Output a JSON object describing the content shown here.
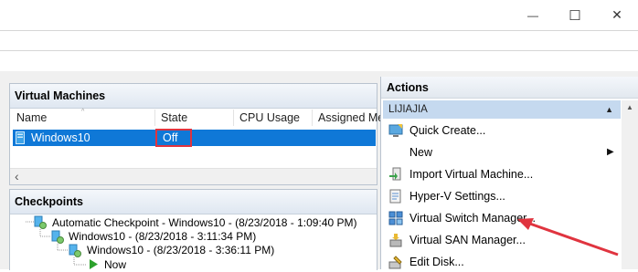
{
  "window": {
    "minimize_glyph": "—",
    "maximize_glyph": "☐",
    "close_glyph": "✕"
  },
  "vm_panel": {
    "title": "Virtual Machines",
    "columns": [
      "Name",
      "State",
      "CPU Usage",
      "Assigned Me"
    ],
    "rows": [
      {
        "name": "Windows10",
        "state": "Off"
      }
    ],
    "scroll_left_glyph": "‹"
  },
  "checkpoints_panel": {
    "title": "Checkpoints",
    "items": [
      {
        "label": "Automatic Checkpoint - Windows10 - (8/23/2018 - 1:09:40 PM)",
        "level": 0
      },
      {
        "label": "Windows10 - (8/23/2018 - 3:11:34 PM)",
        "level": 1
      },
      {
        "label": "Windows10 - (8/23/2018 - 3:36:11 PM)",
        "level": 2
      },
      {
        "label": "Now",
        "level": 3
      }
    ]
  },
  "actions_panel": {
    "title": "Actions",
    "host": "LIJIAJIA",
    "collapse_glyph": "▲",
    "items": [
      {
        "label": "Quick Create...",
        "icon": "quick-create-icon"
      },
      {
        "label": "New",
        "icon": "",
        "submenu_glyph": "▶"
      },
      {
        "label": "Import Virtual Machine...",
        "icon": "import-vm-icon"
      },
      {
        "label": "Hyper-V Settings...",
        "icon": "settings-icon"
      },
      {
        "label": "Virtual Switch Manager...",
        "icon": "virtual-switch-icon"
      },
      {
        "label": "Virtual SAN Manager...",
        "icon": "virtual-san-icon"
      },
      {
        "label": "Edit Disk...",
        "icon": "edit-disk-icon"
      }
    ],
    "scroll_up_glyph": "▲"
  },
  "colors": {
    "selection": "#0f78d7",
    "annotation_red": "#e0343f",
    "host_header": "#c5d9ef"
  }
}
